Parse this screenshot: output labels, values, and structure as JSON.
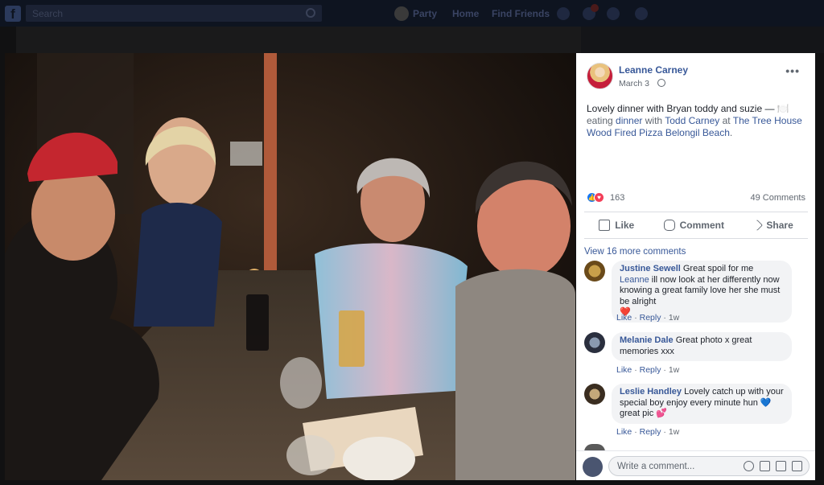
{
  "topbar": {
    "search_placeholder": "Search",
    "nav": [
      "Party",
      "Home",
      "Find Friends"
    ]
  },
  "post": {
    "author": "Leanne Carney",
    "date": "March 3",
    "text_intro": "Lovely dinner with Bryan toddy and suzie",
    "text_dash": " — ",
    "emoji": "🍽️",
    "text_eating": "eating",
    "text_activity": "dinner",
    "text_with": "with",
    "tagged": "Todd Carney",
    "text_at": "at",
    "place": "The Tree House Wood Fired Pizza Belongil Beach",
    "period": "."
  },
  "reactions": {
    "count": "163",
    "comments": "49 Comments"
  },
  "actions": {
    "like": "Like",
    "comment": "Comment",
    "share": "Share"
  },
  "view_more": "View 16 more comments",
  "comments": [
    {
      "author": "Justine Sewell",
      "text_before": " Great spoil for me ",
      "mention": "Leanne",
      "text_after": " ill now look at her differently now knowing a great family love her she must be alright",
      "emoji": "❤️",
      "like": "Like",
      "reply": "Reply",
      "time": "1w"
    },
    {
      "author": "Melanie Dale",
      "text": " Great photo x great memories xxx",
      "like": "Like",
      "reply": "Reply",
      "time": "1w"
    },
    {
      "author": "Leslie Handley",
      "text": " Lovely catch up with your special boy enjoy every minute hun",
      "emoji1": "💙",
      "text2": " great pic",
      "emoji2": "💕",
      "like": "Like",
      "reply": "Reply",
      "time": "1w"
    }
  ],
  "composer": {
    "placeholder": "Write a comment..."
  }
}
